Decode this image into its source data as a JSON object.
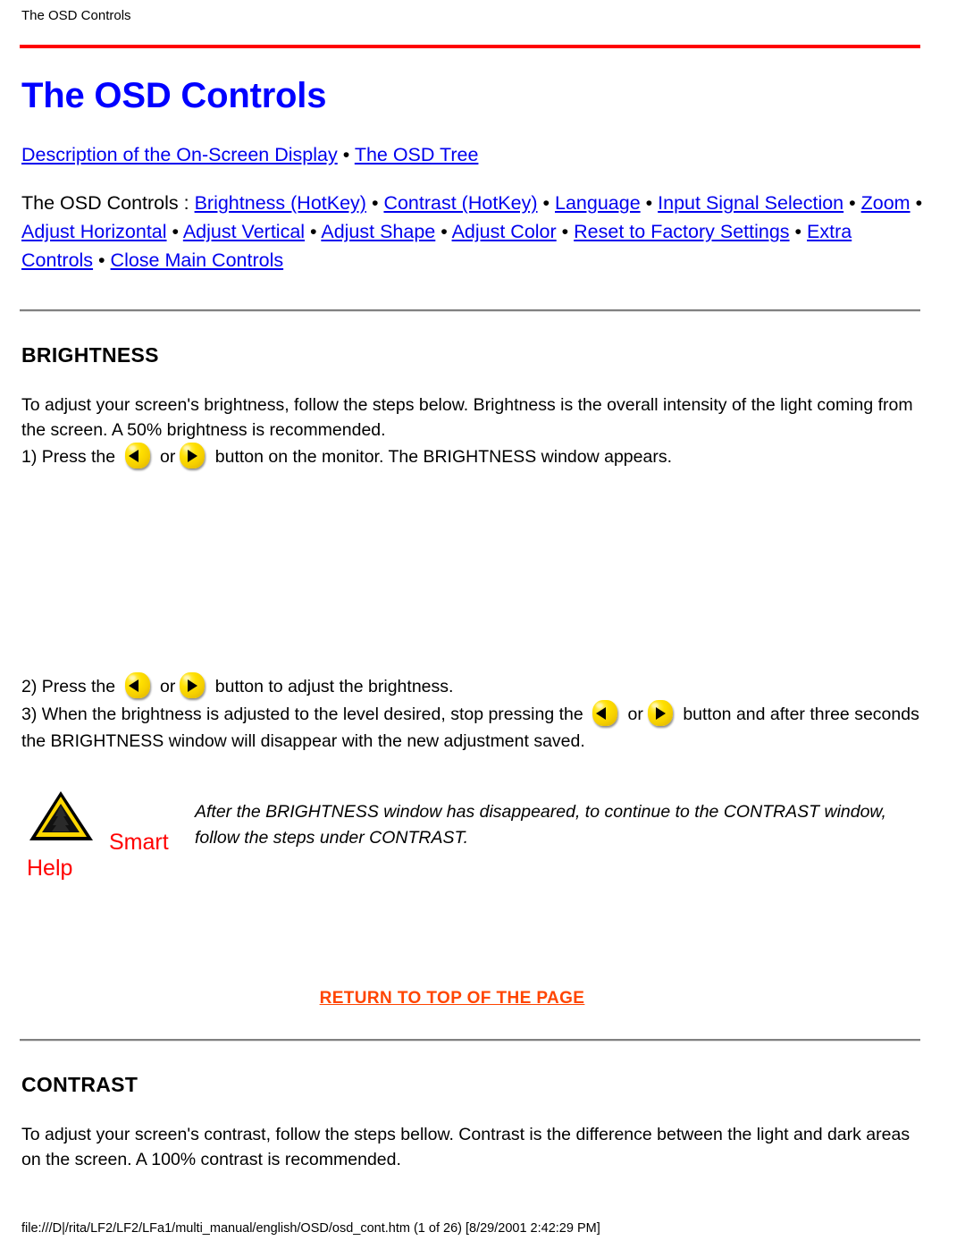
{
  "document": {
    "header_title": "The OSD Controls",
    "page_title": "The OSD Controls",
    "footer": "file:///D|/rita/LF2/LF2/LFa1/multi_manual/english/OSD/osd_cont.htm (1 of 26) [8/29/2001 2:42:29 PM]"
  },
  "colors": {
    "link_blue": "#0000EE",
    "title_blue": "#0000FF",
    "rule_red": "#FF0000",
    "return_orange": "#FF4500",
    "smart_help_red": "#FF0000",
    "button_yellow": "#FFE000"
  },
  "nav": {
    "top_links": [
      {
        "label": "Description of the On-Screen Display"
      },
      {
        "label": "The OSD Tree"
      }
    ],
    "separator": "•",
    "controls_prefix": "The OSD Controls :",
    "control_links": [
      {
        "label": "Brightness (HotKey)"
      },
      {
        "label": "Contrast (HotKey)"
      },
      {
        "label": "Language"
      },
      {
        "label": "Input Signal Selection"
      },
      {
        "label": "Zoom"
      },
      {
        "label": "Adjust Horizontal"
      },
      {
        "label": "Adjust Vertical"
      },
      {
        "label": "Adjust Shape"
      },
      {
        "label": "Adjust Color"
      },
      {
        "label": "Reset to Factory Settings"
      },
      {
        "label": "Extra Controls"
      },
      {
        "label": "Close Main Controls"
      }
    ]
  },
  "brightness": {
    "heading": "BRIGHTNESS",
    "intro": "To adjust your screen's brightness, follow the steps below. Brightness is the overall intensity of the light coming from the screen. A 50% brightness is recommended.",
    "step1_a": "1) Press the",
    "step1_or": "or",
    "step1_b": "button on the monitor. The BRIGHTNESS window appears.",
    "step2_a": "2) Press the",
    "step2_or": "or",
    "step2_b": "button to adjust the brightness.",
    "step3_a": "3) When the brightness is adjusted to the level desired, stop pressing the",
    "step3_or": "or",
    "step3_b": "button and after three seconds the BRIGHTNESS window will disappear with the new adjustment saved."
  },
  "smart_help": {
    "smart_label": "Smart",
    "help_label": "Help",
    "note": "After the BRIGHTNESS window has disappeared, to continue to the CONTRAST window, follow the steps under CONTRAST."
  },
  "return_to_top": {
    "label": "RETURN TO TOP OF THE PAGE"
  },
  "contrast": {
    "heading": "CONTRAST",
    "intro": "To adjust your screen's contrast, follow the steps bellow. Contrast is the difference between the light and dark areas on the screen. A 100% contrast is recommended."
  }
}
